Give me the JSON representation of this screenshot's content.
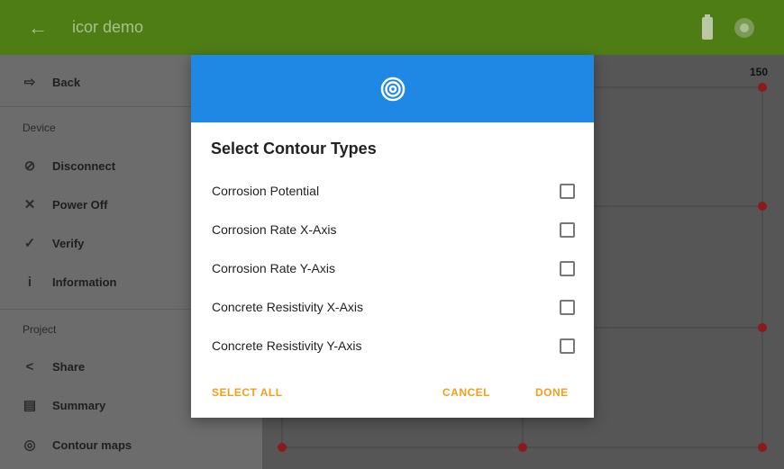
{
  "appbar": {
    "back_glyph": "←",
    "title": "icor demo",
    "icons": [
      "battery-icon",
      "connection-status-icon"
    ]
  },
  "drawer": {
    "items": [
      {
        "label": "Back",
        "icon": "back-doc-icon",
        "glyph": "⇨"
      },
      {
        "label": "Disconnect",
        "icon": "disconnect-icon",
        "glyph": "⊘"
      },
      {
        "label": "Power Off",
        "icon": "power-off-icon",
        "glyph": "✕"
      },
      {
        "label": "Verify",
        "icon": "verify-check-icon",
        "glyph": "✓"
      },
      {
        "label": "Information",
        "icon": "info-icon",
        "glyph": "i"
      },
      {
        "label": "Share",
        "icon": "share-icon",
        "glyph": "<"
      },
      {
        "label": "Summary",
        "icon": "summary-doc-icon",
        "glyph": "▤"
      },
      {
        "label": "Contour maps",
        "icon": "contour-icon",
        "glyph": "◎"
      }
    ],
    "sections": {
      "device": "Device",
      "project": "Project"
    }
  },
  "chart": {
    "axis_value": "150",
    "colors": {
      "grid": "#444444",
      "marker": "#8b1a1a"
    }
  },
  "dialog": {
    "header_icon": "contour-map-icon",
    "header_color": "#1f88e5",
    "title": "Select Contour Types",
    "options": [
      {
        "label": "Corrosion Potential",
        "checked": false
      },
      {
        "label": "Corrosion Rate X-Axis",
        "checked": false
      },
      {
        "label": "Corrosion Rate Y-Axis",
        "checked": false
      },
      {
        "label": "Concrete Resistivity X-Axis",
        "checked": false
      },
      {
        "label": "Concrete Resistivity Y-Axis",
        "checked": false
      }
    ],
    "actions": {
      "select_all": "SELECT ALL",
      "cancel": "CANCEL",
      "done": "DONE",
      "accent": "#f59e1a"
    }
  }
}
